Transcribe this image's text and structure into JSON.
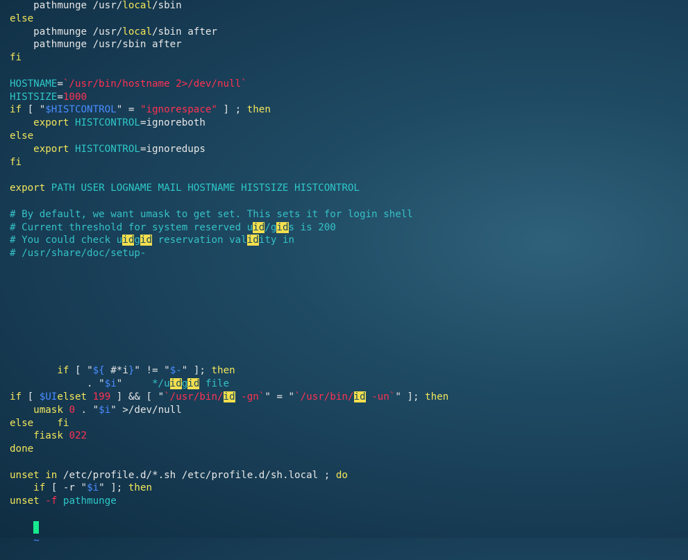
{
  "editor": {
    "tilde": "~",
    "lines": [
      [
        {
          "t": "    pathmunge /usr/",
          "c": "pl"
        },
        {
          "t": "local",
          "c": "kw"
        },
        {
          "t": "/sbin",
          "c": "pl"
        }
      ],
      [
        {
          "t": "else",
          "c": "kw"
        }
      ],
      [
        {
          "t": "    pathmunge /usr/",
          "c": "pl"
        },
        {
          "t": "local",
          "c": "kw"
        },
        {
          "t": "/sbin after",
          "c": "pl"
        }
      ],
      [
        {
          "t": "    pathmunge /usr/sbin after",
          "c": "pl"
        }
      ],
      [
        {
          "t": "fi",
          "c": "kw"
        }
      ],
      [],
      [
        {
          "t": "HOSTNAME",
          "c": "cy"
        },
        {
          "t": "=",
          "c": "pl"
        },
        {
          "t": "`/usr/bin/hostname 2>/dev/null`",
          "c": "st"
        }
      ],
      [
        {
          "t": "HISTSIZE",
          "c": "cy"
        },
        {
          "t": "=",
          "c": "pl"
        },
        {
          "t": "1000",
          "c": "nu"
        }
      ],
      [
        {
          "t": "if",
          "c": "kw"
        },
        {
          "t": " [ ",
          "c": "pl"
        },
        {
          "t": "\"",
          "c": "pl"
        },
        {
          "t": "$HISTCONTROL",
          "c": "vr"
        },
        {
          "t": "\"",
          "c": "pl"
        },
        {
          "t": " = ",
          "c": "pl"
        },
        {
          "t": "\"ignorespace\"",
          "c": "st"
        },
        {
          "t": " ] ; ",
          "c": "pl"
        },
        {
          "t": "then",
          "c": "kw"
        }
      ],
      [
        {
          "t": "    ",
          "c": "pl"
        },
        {
          "t": "export",
          "c": "kw"
        },
        {
          "t": " ",
          "c": "pl"
        },
        {
          "t": "HISTCONTROL",
          "c": "cy"
        },
        {
          "t": "=",
          "c": "pl"
        },
        {
          "t": "ignoreboth",
          "c": "pl"
        }
      ],
      [
        {
          "t": "else",
          "c": "kw"
        }
      ],
      [
        {
          "t": "    ",
          "c": "pl"
        },
        {
          "t": "export",
          "c": "kw"
        },
        {
          "t": " ",
          "c": "pl"
        },
        {
          "t": "HISTCONTROL",
          "c": "cy"
        },
        {
          "t": "=",
          "c": "pl"
        },
        {
          "t": "ignoredups",
          "c": "pl"
        }
      ],
      [
        {
          "t": "fi",
          "c": "kw"
        }
      ],
      [],
      [
        {
          "t": "export",
          "c": "kw"
        },
        {
          "t": " PATH USER LOGNAME MAIL HOSTNAME HISTSIZE HISTCONTROL",
          "c": "cy"
        }
      ],
      [],
      [
        {
          "t": "# By default, we want umask to get set. This sets it for login shell",
          "c": "cm"
        }
      ],
      [
        {
          "t": "# Current threshold for system reserved u",
          "c": "cm"
        },
        {
          "t": "id",
          "c": "hl"
        },
        {
          "t": "/g",
          "c": "cm"
        },
        {
          "t": "id",
          "c": "hl"
        },
        {
          "t": "s is 200",
          "c": "cm"
        }
      ],
      [
        {
          "t": "# You could check u",
          "c": "cm"
        },
        {
          "t": "id",
          "c": "hl"
        },
        {
          "t": "g",
          "c": "cm"
        },
        {
          "t": "id",
          "c": "hl"
        },
        {
          "t": " reservation val",
          "c": "cm"
        },
        {
          "t": "id",
          "c": "hl"
        },
        {
          "t": "ity in",
          "c": "cm"
        }
      ],
      [
        {
          "t": "# /usr/share/doc/setup-",
          "c": "cm"
        }
      ],
      [],
      [],
      [],
      [],
      [],
      [],
      [],
      [],
      [
        {
          "t": "        ",
          "c": "pl"
        },
        {
          "t": "if",
          "c": "kw"
        },
        {
          "t": " [ ",
          "c": "pl"
        },
        {
          "t": "\"",
          "c": "pl"
        },
        {
          "t": "${",
          "c": "vr"
        },
        {
          "t": " #*i",
          "c": "pl"
        },
        {
          "t": "}",
          "c": "vr"
        },
        {
          "t": "\"",
          "c": "pl"
        },
        {
          "t": " != ",
          "c": "pl"
        },
        {
          "t": "\"",
          "c": "pl"
        },
        {
          "t": "$-",
          "c": "vr"
        },
        {
          "t": "\"",
          "c": "pl"
        },
        {
          "t": " ]; ",
          "c": "pl"
        },
        {
          "t": "then",
          "c": "kw"
        }
      ],
      [
        {
          "t": "             . ",
          "c": "pl"
        },
        {
          "t": "\"",
          "c": "pl"
        },
        {
          "t": "$i",
          "c": "vr"
        },
        {
          "t": "\"",
          "c": "pl"
        },
        {
          "t": "     */u",
          "c": "cm"
        },
        {
          "t": "id",
          "c": "hl"
        },
        {
          "t": "g",
          "c": "cm"
        },
        {
          "t": "id",
          "c": "hl"
        },
        {
          "t": " file",
          "c": "cm"
        }
      ],
      [
        {
          "t": "if",
          "c": "kw"
        },
        {
          "t": " [ ",
          "c": "pl"
        },
        {
          "t": "$UI",
          "c": "vr"
        },
        {
          "t": "elset",
          "c": "kw"
        },
        {
          "t": " ",
          "c": "pl"
        },
        {
          "t": "199",
          "c": "nu"
        },
        {
          "t": " ] && [ ",
          "c": "pl"
        },
        {
          "t": "\"",
          "c": "pl"
        },
        {
          "t": "`/usr/bin/",
          "c": "st"
        },
        {
          "t": "id",
          "c": "hl"
        },
        {
          "t": " -gn`",
          "c": "st"
        },
        {
          "t": "\"",
          "c": "pl"
        },
        {
          "t": " = ",
          "c": "pl"
        },
        {
          "t": "\"",
          "c": "pl"
        },
        {
          "t": "`/usr/bin/",
          "c": "st"
        },
        {
          "t": "id",
          "c": "hl"
        },
        {
          "t": " -un`",
          "c": "st"
        },
        {
          "t": "\"",
          "c": "pl"
        },
        {
          "t": " ]; ",
          "c": "pl"
        },
        {
          "t": "then",
          "c": "kw"
        }
      ],
      [
        {
          "t": "    ",
          "c": "pl"
        },
        {
          "t": "umask",
          "c": "kw"
        },
        {
          "t": " ",
          "c": "pl"
        },
        {
          "t": "0",
          "c": "nu"
        },
        {
          "t": " . ",
          "c": "pl"
        },
        {
          "t": "\"",
          "c": "pl"
        },
        {
          "t": "$i",
          "c": "vr"
        },
        {
          "t": "\"",
          "c": "pl"
        },
        {
          "t": " >/dev/null",
          "c": "pl"
        }
      ],
      [
        {
          "t": "else",
          "c": "kw"
        },
        {
          "t": "    ",
          "c": "pl"
        },
        {
          "t": "fi",
          "c": "kw"
        }
      ],
      [
        {
          "t": "    ",
          "c": "pl"
        },
        {
          "t": "fiask",
          "c": "kw"
        },
        {
          "t": " ",
          "c": "pl"
        },
        {
          "t": "022",
          "c": "nu"
        }
      ],
      [
        {
          "t": "done",
          "c": "kw"
        }
      ],
      [],
      [
        {
          "t": "unset",
          "c": "kw"
        },
        {
          "t": " ",
          "c": "pl"
        },
        {
          "t": "in",
          "c": "kw"
        },
        {
          "t": " /etc/profile.d/*.sh /etc/profile.d/sh.local ; ",
          "c": "pl"
        },
        {
          "t": "do",
          "c": "kw"
        }
      ],
      [
        {
          "t": "    ",
          "c": "pl"
        },
        {
          "t": "if",
          "c": "kw"
        },
        {
          "t": " [ -r ",
          "c": "pl"
        },
        {
          "t": "\"",
          "c": "pl"
        },
        {
          "t": "$i",
          "c": "vr"
        },
        {
          "t": "\"",
          "c": "pl"
        },
        {
          "t": " ]; ",
          "c": "pl"
        },
        {
          "t": "then",
          "c": "kw"
        }
      ],
      [
        {
          "t": "unset",
          "c": "kw"
        },
        {
          "t": " ",
          "c": "pl"
        },
        {
          "t": "-f",
          "c": "st"
        },
        {
          "t": " pathmunge",
          "c": "cy"
        }
      ]
    ]
  }
}
